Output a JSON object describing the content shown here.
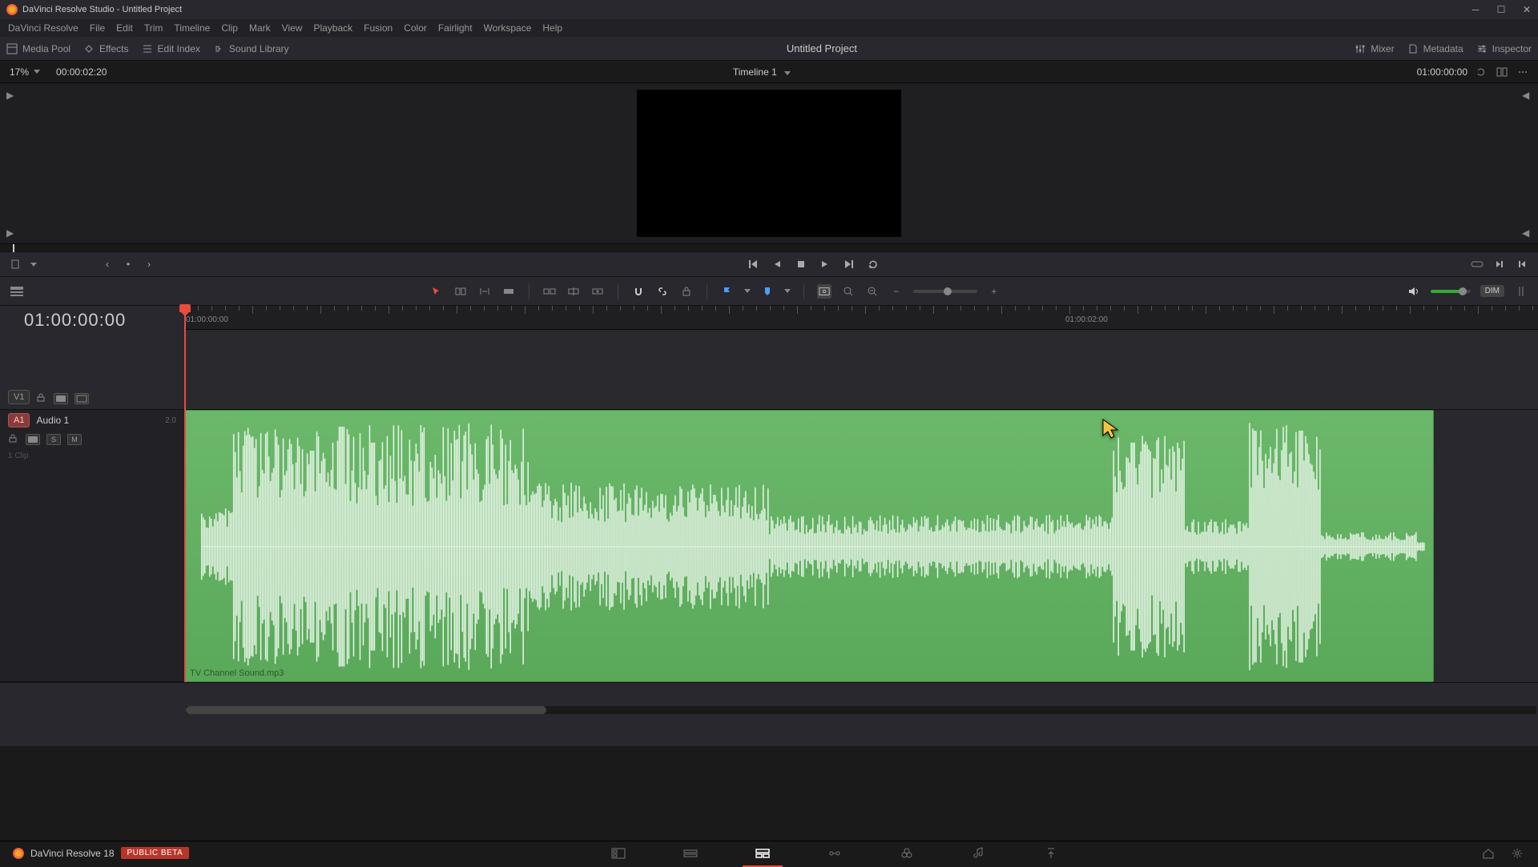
{
  "window": {
    "title": "DaVinci Resolve Studio - Untitled Project"
  },
  "menu": {
    "items": [
      "DaVinci Resolve",
      "File",
      "Edit",
      "Trim",
      "Timeline",
      "Clip",
      "Mark",
      "View",
      "Playback",
      "Fusion",
      "Color",
      "Fairlight",
      "Workspace",
      "Help"
    ]
  },
  "toolbar": {
    "media_pool": "Media Pool",
    "effects": "Effects",
    "edit_index": "Edit Index",
    "sound_library": "Sound Library",
    "project_title": "Untitled Project",
    "mixer": "Mixer",
    "metadata": "Metadata",
    "inspector": "Inspector"
  },
  "viewer": {
    "zoom": "17%",
    "timecode_left": "00:00:02:20",
    "timeline_name": "Timeline 1",
    "timecode_right": "01:00:00:00"
  },
  "timeline": {
    "big_timecode": "01:00:00:00",
    "ruler": {
      "label1": "01:00:00:00",
      "label2": "01:00:02:00"
    },
    "video_track": {
      "badge": "V1"
    },
    "audio_track": {
      "badge": "A1",
      "name": "Audio 1",
      "channels": "2.0",
      "solo": "S",
      "mute": "M",
      "clips": "1 Clip"
    },
    "clip": {
      "name": "TV Channel Sound.mp3"
    }
  },
  "edit_toolbar": {
    "dim": "DIM"
  },
  "footer": {
    "brand": "DaVinci Resolve 18",
    "beta": "PUBLIC BETA"
  }
}
